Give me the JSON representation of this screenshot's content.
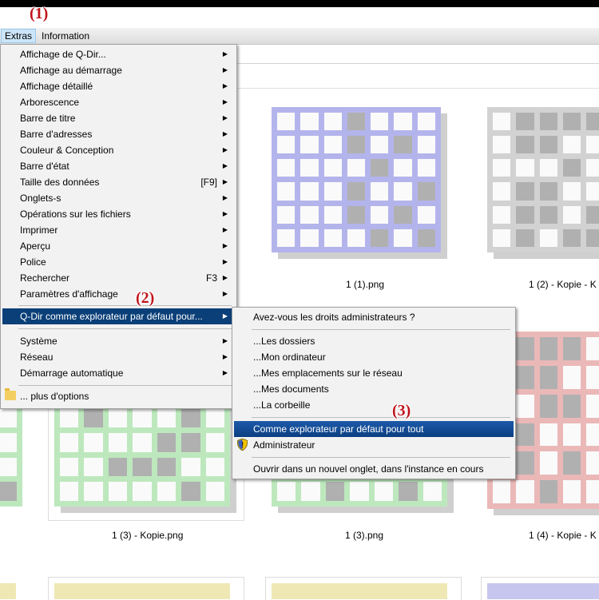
{
  "menubar": {
    "items": [
      "Extras",
      "Information"
    ]
  },
  "badges": [
    "(1)",
    "(2)",
    "(3)"
  ],
  "extras_menu": {
    "items": [
      {
        "label": "Affichage de Q-Dir...",
        "shortcut": "",
        "submenu": true
      },
      {
        "label": "Affichage au démarrage",
        "shortcut": "",
        "submenu": true
      },
      {
        "label": "Affichage détaillé",
        "shortcut": "",
        "submenu": true
      },
      {
        "label": "Arborescence",
        "shortcut": "",
        "submenu": true
      },
      {
        "label": "Barre de titre",
        "shortcut": "",
        "submenu": true
      },
      {
        "label": "Barre d'adresses",
        "shortcut": "",
        "submenu": true
      },
      {
        "label": "Couleur & Conception",
        "shortcut": "",
        "submenu": true
      },
      {
        "label": "Barre d'état",
        "shortcut": "",
        "submenu": true
      },
      {
        "label": "Taille des données",
        "shortcut": "[F9]",
        "submenu": true
      },
      {
        "label": "Onglets-s",
        "shortcut": "",
        "submenu": true
      },
      {
        "label": "Opérations sur les fichiers",
        "shortcut": "",
        "submenu": true
      },
      {
        "label": "Imprimer",
        "shortcut": "",
        "submenu": true
      },
      {
        "label": "Aperçu",
        "shortcut": "",
        "submenu": true
      },
      {
        "label": "Police",
        "shortcut": "",
        "submenu": true
      },
      {
        "label": "Rechercher",
        "shortcut": "F3",
        "submenu": true
      },
      {
        "label": "Paramètres d'affichage",
        "shortcut": "",
        "submenu": true
      }
    ],
    "qdir_item": "Q-Dir comme explorateur par défaut pour...",
    "items2": [
      {
        "label": "Système"
      },
      {
        "label": "Réseau"
      },
      {
        "label": "Démarrage automatique"
      }
    ],
    "more_options": "... plus d'options"
  },
  "sub_menu": {
    "admin_question": "Avez-vous les droits administrateurs ?",
    "targets": [
      "...Les dossiers",
      "...Mon ordinateur",
      "...Mes emplacements sur le réseau",
      "...Mes documents",
      "...La corbeille"
    ],
    "default_all": "Comme explorateur par défaut pour tout",
    "administrator": "Administrateur",
    "open_new_tab": "Ouvrir dans un nouvel onglet, dans l'instance en cours"
  },
  "files": [
    {
      "name": "1 (1).png",
      "color": "#b4b4ec"
    },
    {
      "name": "1 (2) - Kopie - K",
      "color": "#d2d2d2"
    },
    {
      "name": "1 (3) - Kopie.png",
      "color": "#bde8bd"
    },
    {
      "name": "1 (3).png",
      "color": "#bde8bd"
    },
    {
      "name": "1 (4) - Kopie - K",
      "color": "#ebb8b8"
    }
  ],
  "colors": {
    "menu_bg": "#f2f2f2",
    "highlight": "#0a3f78",
    "badge": "#c0141c"
  }
}
